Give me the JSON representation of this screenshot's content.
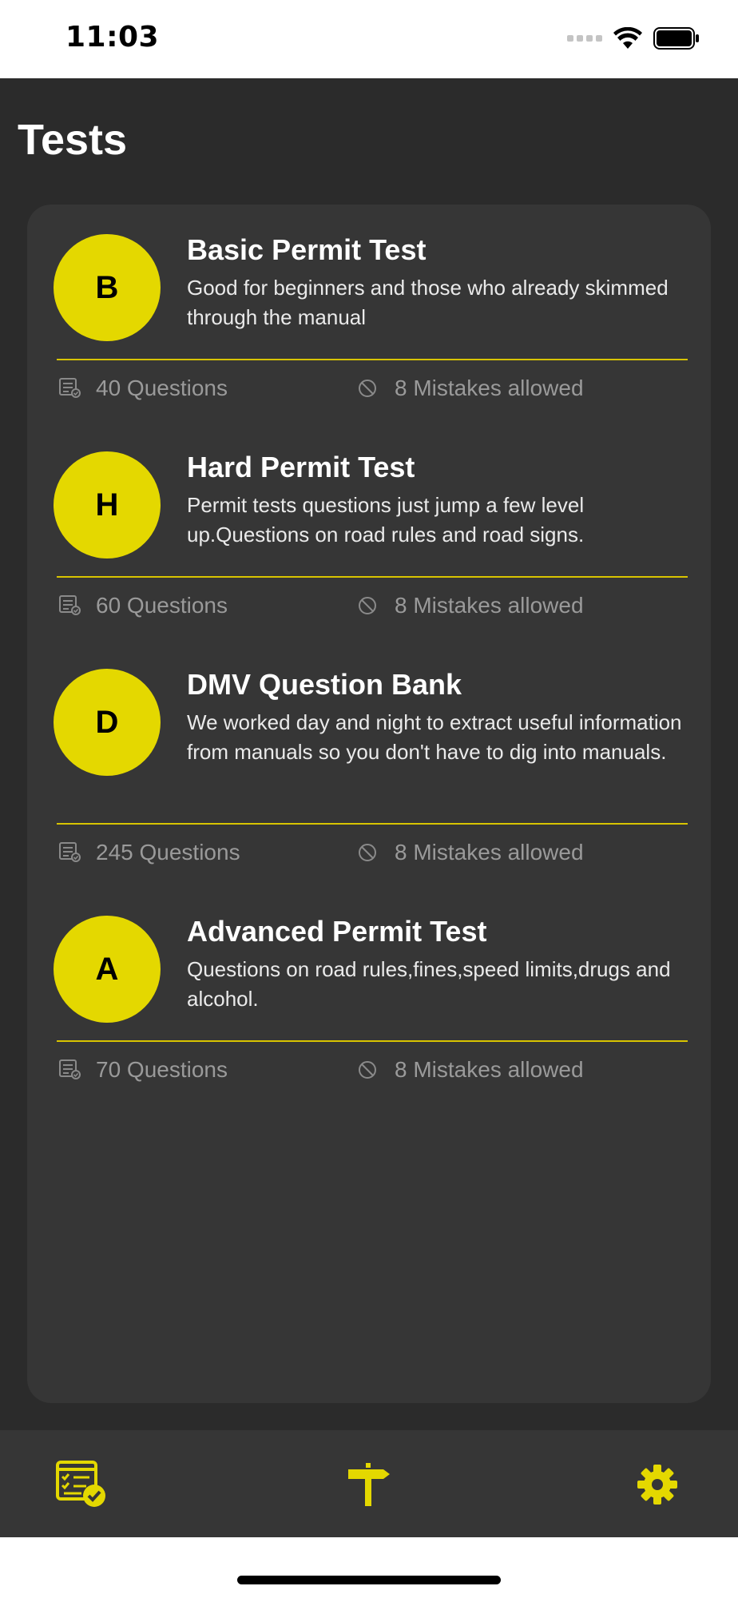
{
  "status_bar": {
    "time": "11:03"
  },
  "page": {
    "title": "Tests"
  },
  "tests": [
    {
      "letter": "B",
      "name": "Basic Permit Test",
      "description": "Good for beginners and those who already skimmed through the manual",
      "questions": "40 Questions",
      "mistakes": "8 Mistakes allowed"
    },
    {
      "letter": "H",
      "name": "Hard Permit Test",
      "description": "Permit tests questions just jump a few level up.Questions on road rules and road signs.",
      "questions": "60 Questions",
      "mistakes": "8 Mistakes allowed"
    },
    {
      "letter": "D",
      "name": "DMV Question Bank",
      "description": "We worked day and night to extract useful information from manuals so you don't have to dig into manuals.",
      "questions": "245 Questions",
      "mistakes": "8 Mistakes allowed"
    },
    {
      "letter": "A",
      "name": "Advanced Permit Test",
      "description": "Questions on road rules,fines,speed limits,drugs and alcohol.",
      "questions": "70 Questions",
      "mistakes": "8 Mistakes allowed"
    }
  ],
  "tab_bar": {
    "tabs": [
      {
        "icon": "tests-checklist-icon",
        "active": true
      },
      {
        "icon": "signpost-icon",
        "active": false
      },
      {
        "icon": "gear-icon",
        "active": false
      }
    ]
  },
  "colors": {
    "accent": "#e4d800",
    "background": "#2b2b2b",
    "card": "#363636",
    "meta_text": "#9a9a9a"
  }
}
